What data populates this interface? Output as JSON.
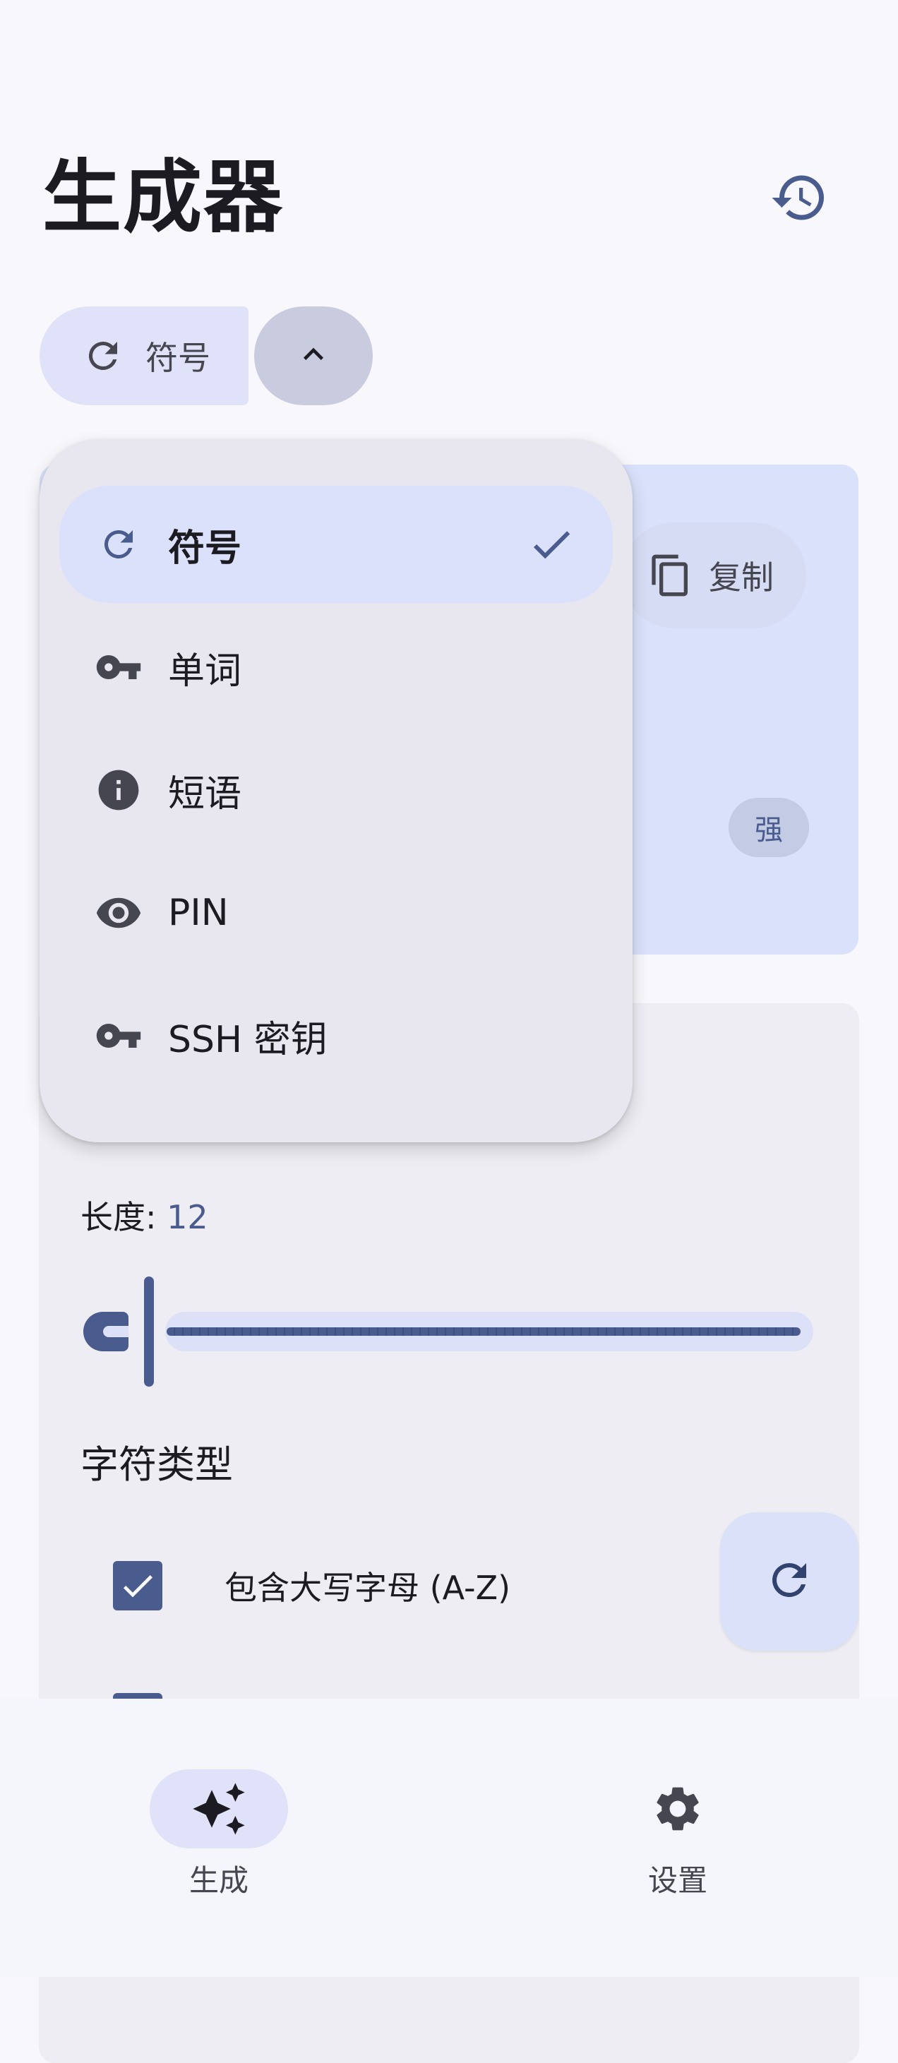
{
  "header": {
    "title": "生成器"
  },
  "type_selector": {
    "selected_label": "符号"
  },
  "password_card": {
    "copy_label": "复制",
    "strength_label": "强"
  },
  "menu": {
    "items": [
      {
        "label": "符号",
        "icon": "refresh-icon",
        "selected": true
      },
      {
        "label": "单词",
        "icon": "key-icon",
        "selected": false
      },
      {
        "label": "短语",
        "icon": "info-icon",
        "selected": false
      },
      {
        "label": "PIN",
        "icon": "eye-icon",
        "selected": false
      },
      {
        "label": "SSH 密钥",
        "icon": "key-icon",
        "selected": false
      }
    ]
  },
  "options": {
    "length_label": "长度: ",
    "length_value": "12",
    "charset_title": "字符类型",
    "checkboxes": [
      {
        "label": "包含大写字母 (A-Z)",
        "checked": true
      }
    ]
  },
  "bottom_nav": {
    "items": [
      {
        "label": "生成",
        "icon": "sparkle-icon",
        "active": true
      },
      {
        "label": "设置",
        "icon": "gear-icon",
        "active": false
      }
    ]
  },
  "colors": {
    "accent": "#4a5b8e",
    "surface": "#f8f8fc",
    "menu": "#e8e6ee",
    "selected": "#dce1fb"
  }
}
